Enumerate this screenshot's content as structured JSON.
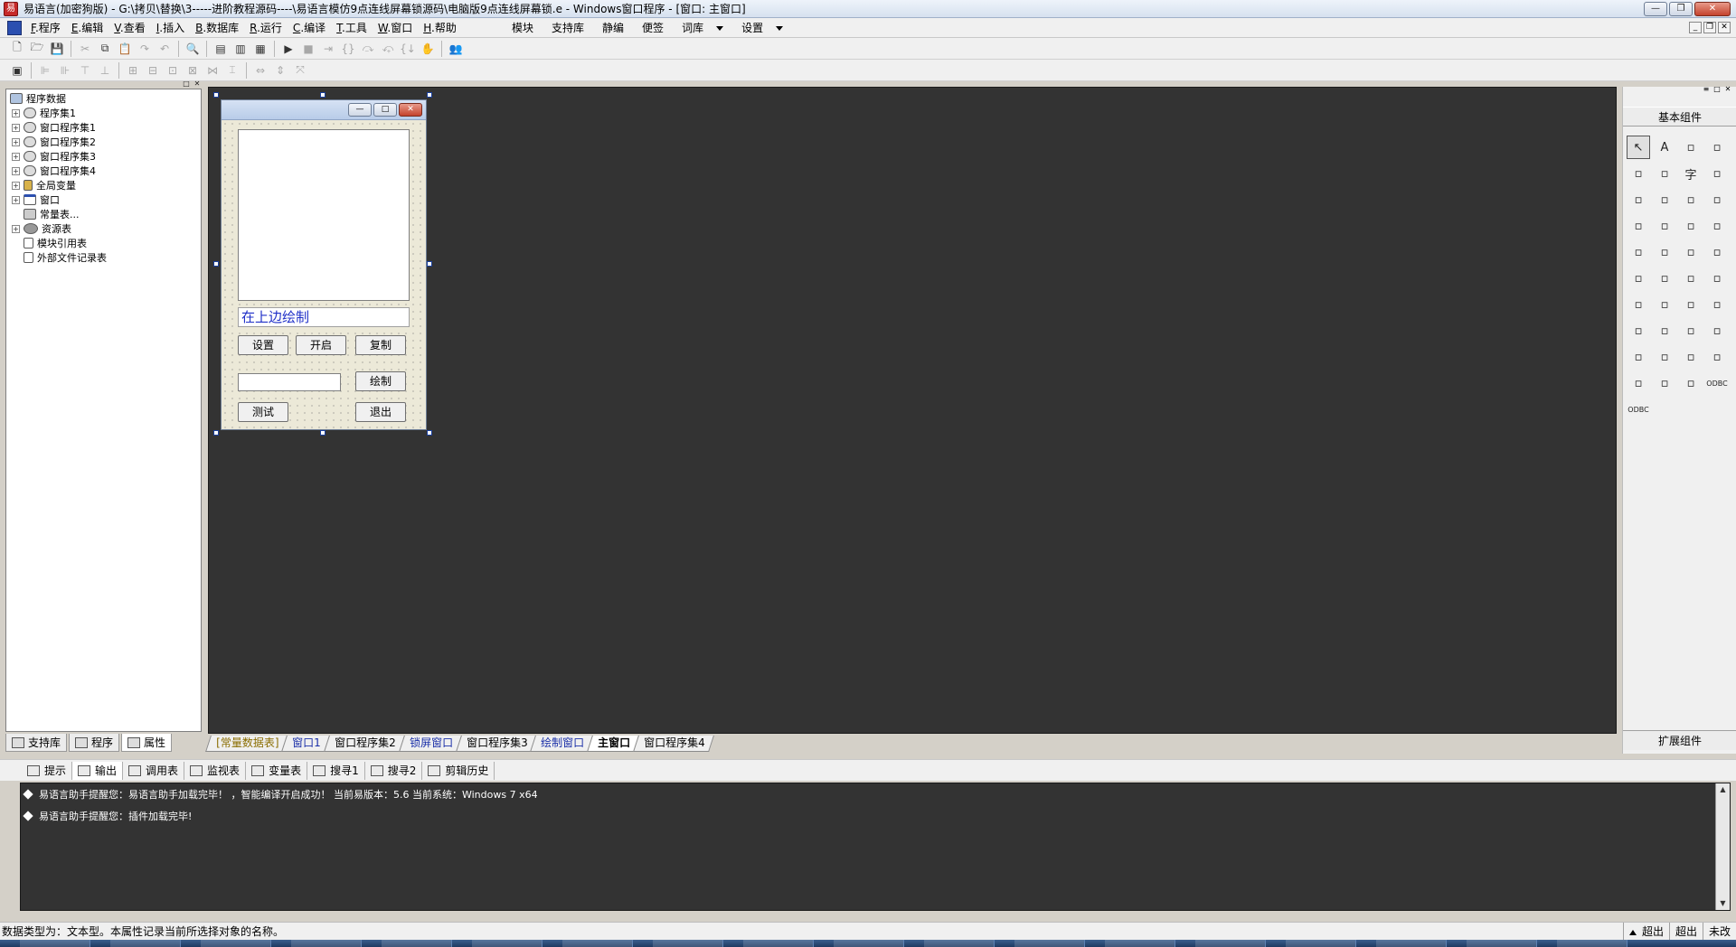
{
  "titlebar": {
    "title": "易语言(加密狗版) - G:\\拷贝\\替换\\3-----进阶教程源码----\\易语言模仿9点连线屏幕锁源码\\电脑版9点连线屏幕锁.e - Windows窗口程序 - [窗口: 主窗口]",
    "minimize": "—",
    "maximize": "❐",
    "close": "✕"
  },
  "menubar": {
    "items": [
      {
        "key": "F",
        "label": ".程序"
      },
      {
        "key": "E",
        "label": ".编辑"
      },
      {
        "key": "V",
        "label": ".查看"
      },
      {
        "key": "I",
        "label": ".插入"
      },
      {
        "key": "B",
        "label": ".数据库"
      },
      {
        "key": "R",
        "label": ".运行"
      },
      {
        "key": "C",
        "label": ".编译"
      },
      {
        "key": "T",
        "label": ".工具"
      },
      {
        "key": "W",
        "label": ".窗口"
      },
      {
        "key": "H",
        "label": ".帮助"
      }
    ],
    "right_items": [
      "模块",
      "支持库",
      "静编",
      "便签",
      "词库",
      "设置"
    ]
  },
  "left_panel": {
    "tree": [
      {
        "label": "程序数据",
        "level": 0,
        "icon": "root"
      },
      {
        "label": "程序集1",
        "level": 1,
        "icon": "set",
        "expander": "+"
      },
      {
        "label": "窗口程序集1",
        "level": 1,
        "icon": "set",
        "expander": "+"
      },
      {
        "label": "窗口程序集2",
        "level": 1,
        "icon": "set",
        "expander": "+"
      },
      {
        "label": "窗口程序集3",
        "level": 1,
        "icon": "set",
        "expander": "+"
      },
      {
        "label": "窗口程序集4",
        "level": 1,
        "icon": "set",
        "expander": "+"
      },
      {
        "label": "全局变量",
        "level": 1,
        "icon": "var",
        "expander": "+"
      },
      {
        "label": "窗口",
        "level": 1,
        "icon": "win",
        "expander": "+"
      },
      {
        "label": "常量表...",
        "level": 1,
        "icon": "const",
        "expander": ""
      },
      {
        "label": "资源表",
        "level": 1,
        "icon": "res",
        "expander": "+"
      },
      {
        "label": "模块引用表",
        "level": 1,
        "icon": "doc",
        "expander": ""
      },
      {
        "label": "外部文件记录表",
        "level": 1,
        "icon": "doc",
        "expander": ""
      }
    ],
    "tabs": [
      "支持库",
      "程序",
      "属性"
    ]
  },
  "design_form": {
    "label_text": "在上边绘制",
    "buttons": {
      "settings": "设置",
      "start": "开启",
      "copy": "复制",
      "draw": "绘制",
      "test": "测试",
      "exit": "退出"
    }
  },
  "right_panel": {
    "title": "基本组件",
    "bottom": "扩展组件",
    "tools": [
      "pointer-icon",
      "label-icon",
      "picture-icon",
      "shape-icon",
      "edit-icon",
      "frame-icon",
      "text-icon",
      "line-icon",
      "checkbox-icon",
      "radio-icon",
      "listbox-icon",
      "combobox-icon",
      "grid-icon",
      "scrollbar-icon",
      "slider-icon",
      "ruler-icon",
      "progress-icon",
      "splitter-icon",
      "tab-icon",
      "image-icon",
      "calendar-icon",
      "toolbar-icon",
      "dir-icon",
      "file-icon",
      "statusbar-icon",
      "printer-icon",
      "column-icon",
      "table-icon",
      "timer-icon",
      "print-icon",
      "db-link-icon",
      "db-link2-icon",
      "db-icon",
      "db2-icon",
      "panel-icon",
      "list-icon",
      "data-icon",
      "data2-icon",
      "chart-icon",
      "odbc-icon",
      "odbc2-icon"
    ],
    "tool_glyphs": {
      "label-icon": "A",
      "text-icon": "字",
      "odbc-icon": "ODBC",
      "odbc2-icon": "ODBC"
    }
  },
  "doc_tabs": [
    {
      "label": "[常量数据表]",
      "style": "const"
    },
    {
      "label": "窗口1",
      "style": "blue"
    },
    {
      "label": "窗口程序集2",
      "style": ""
    },
    {
      "label": "锁屏窗口",
      "style": "blue"
    },
    {
      "label": "窗口程序集3",
      "style": ""
    },
    {
      "label": "绘制窗口",
      "style": "blue"
    },
    {
      "label": "主窗口",
      "style": "active"
    },
    {
      "label": "窗口程序集4",
      "style": ""
    }
  ],
  "output": {
    "tabs": [
      "提示",
      "输出",
      "调用表",
      "监视表",
      "变量表",
      "搜寻1",
      "搜寻2",
      "剪辑历史"
    ],
    "lines": [
      "易语言助手提醒您：易语言助手加载完毕！  ，智能编译开启成功！  当前易版本：5.6  当前系统：Windows 7 x64",
      "易语言助手提醒您：插件加载完毕!"
    ]
  },
  "statusbar": {
    "text": "数据类型为：文本型。本属性记录当前所选择对象的名称。",
    "cells": [
      "超出",
      "超出",
      "未改"
    ]
  },
  "colors": {
    "workspace": "#333333",
    "label_text": "#2030c8"
  }
}
